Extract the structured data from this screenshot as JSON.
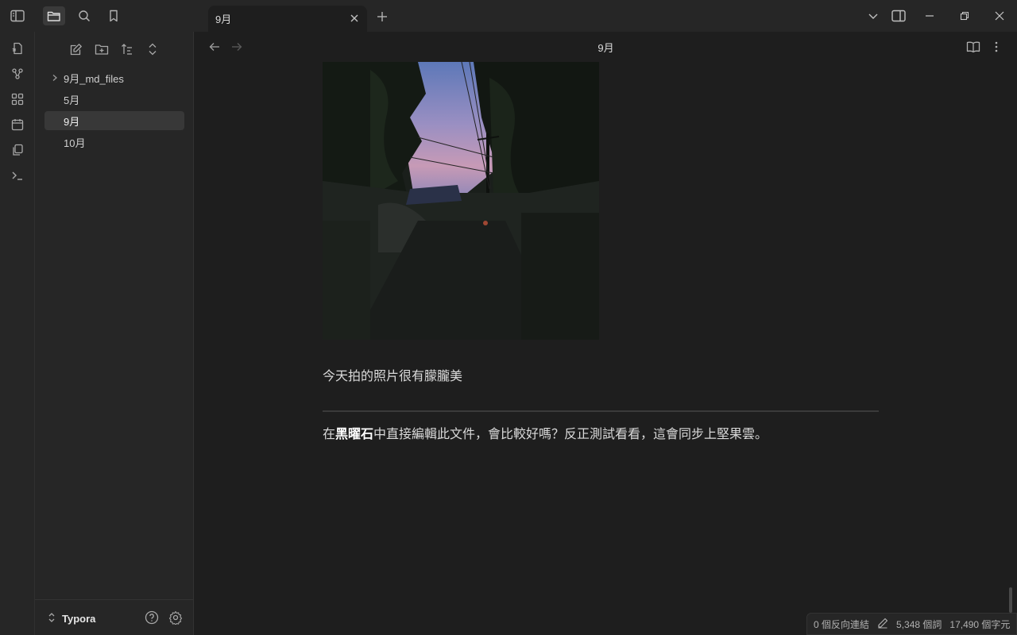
{
  "titlebar": {
    "tab_title": "9月"
  },
  "ribbon": {
    "icons": [
      "open-quick-switcher-icon",
      "graph-view-icon",
      "canvas-icon",
      "daily-note-icon",
      "templates-icon",
      "command-palette-icon"
    ]
  },
  "sidebar": {
    "files": [
      {
        "label": "9月_md_files",
        "type": "folder",
        "collapsed": true
      },
      {
        "label": "5月",
        "type": "file"
      },
      {
        "label": "9月",
        "type": "file",
        "active": true
      },
      {
        "label": "10月",
        "type": "file"
      }
    ],
    "vault_name": "Typora"
  },
  "view": {
    "title": "9月"
  },
  "document": {
    "caption": "今天拍的照片很有朦朧美",
    "para_prefix": "在",
    "para_bold": "黑曜石",
    "para_suffix": "中直接編輯此文件，會比較好嗎？反正測試看看，這會同步上堅果雲。"
  },
  "status": {
    "backlinks": "0 個反向連結",
    "words": "5,348 個詞",
    "chars": "17,490 個字元"
  },
  "colors": {
    "background": "#1e1e1e",
    "sidebar": "#262626",
    "active_item": "#383838"
  }
}
